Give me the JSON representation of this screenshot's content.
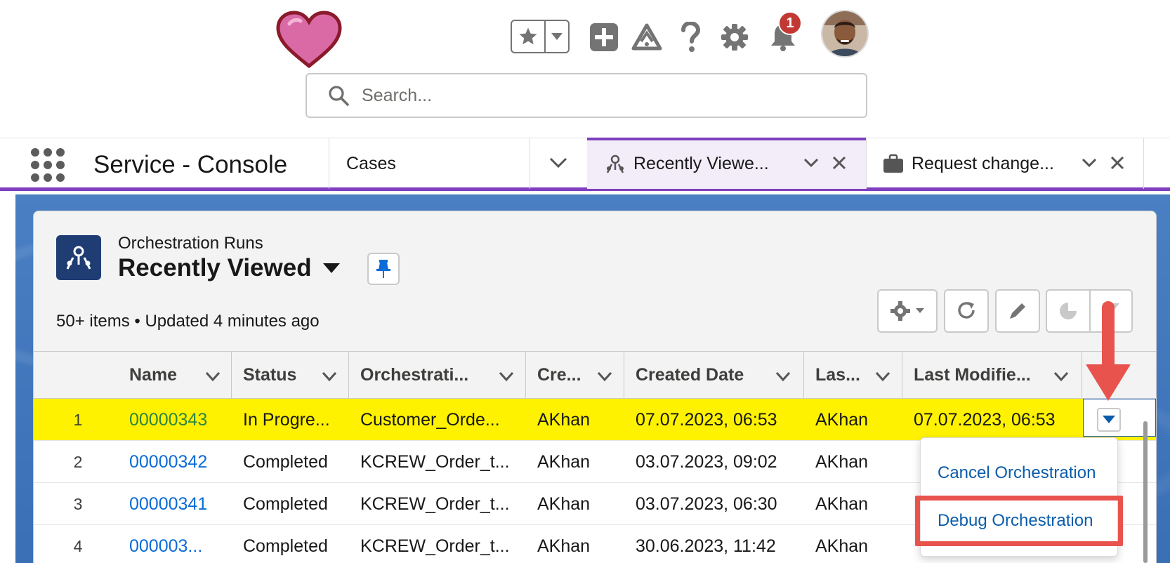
{
  "header": {
    "search": {
      "placeholder": "Search..."
    },
    "notifications": {
      "count": "1"
    },
    "icons": [
      "heart-logo-icon",
      "star-icon",
      "chevron-down-icon",
      "plus-icon",
      "trailhead-icon",
      "question-icon",
      "setup-gear-icon",
      "bell-icon"
    ]
  },
  "nav": {
    "app_name": "Service - Console",
    "object_nav": "Cases",
    "tabs": [
      {
        "label": "Recently Viewe...",
        "icon": "orchestration-icon",
        "active": true
      },
      {
        "label": "Request change...",
        "icon": "briefcase-icon",
        "active": false
      }
    ]
  },
  "list": {
    "object_label": "Orchestration Runs",
    "title": "Recently Viewed",
    "meta": "50+ items • Updated 4 minutes ago",
    "columns": [
      "Name",
      "Status",
      "Orchestrati...",
      "Cre...",
      "Created Date",
      "Las...",
      "Last Modifie..."
    ],
    "rows": [
      {
        "num": "1",
        "name": "00000343",
        "status": "In Progre...",
        "orch": "Customer_Orde...",
        "created_by": "AKhan",
        "created_date": "07.07.2023, 06:53",
        "last_by": "AKhan",
        "last_mod": "07.07.2023, 06:53"
      },
      {
        "num": "2",
        "name": "00000342",
        "status": "Completed",
        "orch": "KCREW_Order_t...",
        "created_by": "AKhan",
        "created_date": "03.07.2023, 09:02",
        "last_by": "AKhan",
        "last_mod": ""
      },
      {
        "num": "3",
        "name": "00000341",
        "status": "Completed",
        "orch": "KCREW_Order_t...",
        "created_by": "AKhan",
        "created_date": "03.07.2023, 06:30",
        "last_by": "AKhan",
        "last_mod": ""
      },
      {
        "num": "4",
        "name": "000003...",
        "status": "Completed",
        "orch": "KCREW_Order_t...",
        "created_by": "AKhan",
        "created_date": "30.06.2023, 11:42",
        "last_by": "AKhan",
        "last_mod": ""
      }
    ]
  },
  "row_menu": {
    "items": [
      "Cancel Orchestration",
      "Debug Orchestration"
    ],
    "highlighted": "Debug Orchestration"
  },
  "colors": {
    "accent_purple": "#7f3fbf",
    "row_highlight": "#fff200",
    "link_blue": "#0b6cd8",
    "annotation_red": "#e8534d",
    "badge_red": "#c23934"
  }
}
